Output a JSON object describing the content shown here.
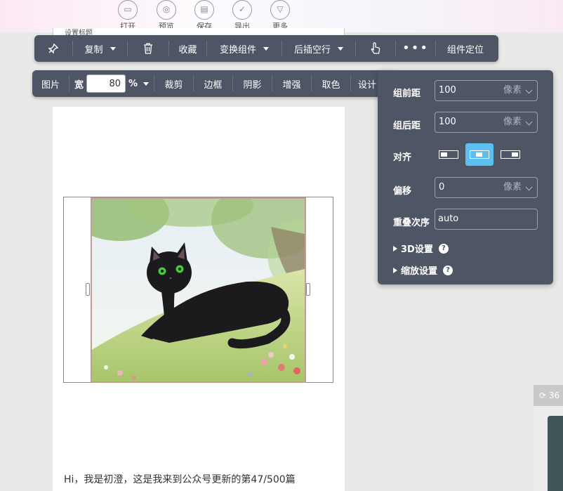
{
  "topbar": {
    "buttons": [
      {
        "label": "打开",
        "icon": "folder-icon"
      },
      {
        "label": "预览",
        "icon": "preview-icon"
      },
      {
        "label": "保存",
        "icon": "save-icon"
      },
      {
        "label": "导出",
        "icon": "export-icon"
      },
      {
        "label": "更多",
        "icon": "more-icon"
      }
    ]
  },
  "editor_stub_text": "设置标题",
  "toolbar1": {
    "copy": "复制",
    "favorite": "收藏",
    "transform": "变换组件",
    "insert_after": "后插空行",
    "more": "•••",
    "locate": "组件定位"
  },
  "toolbar2": {
    "image": "图片",
    "width_label": "宽",
    "width_value": "80",
    "unit": "%",
    "crop": "裁剪",
    "border": "边框",
    "shadow": "阴影",
    "enhance": "增强",
    "pick_color": "取色",
    "design": "设计"
  },
  "popover": {
    "before_label": "组前距",
    "before_value": "100",
    "before_unit": "像素",
    "after_label": "组后距",
    "after_value": "100",
    "after_unit": "像素",
    "align_label": "对齐",
    "align_selected": "center",
    "offset_label": "偏移",
    "offset_value": "0",
    "offset_unit": "像素",
    "zorder_label": "重叠次序",
    "zorder_value": "auto",
    "settings_3d": "3D设置",
    "scale_settings": "缩放设置"
  },
  "body_text": "Hi，我是初澄，这是我来到公众号更新的第47/500篇",
  "side_widget_text": "36",
  "colors": {
    "toolbar_bg": "#4e5564",
    "align_active": "#5bc0f0",
    "image_border": "#c89b92"
  }
}
